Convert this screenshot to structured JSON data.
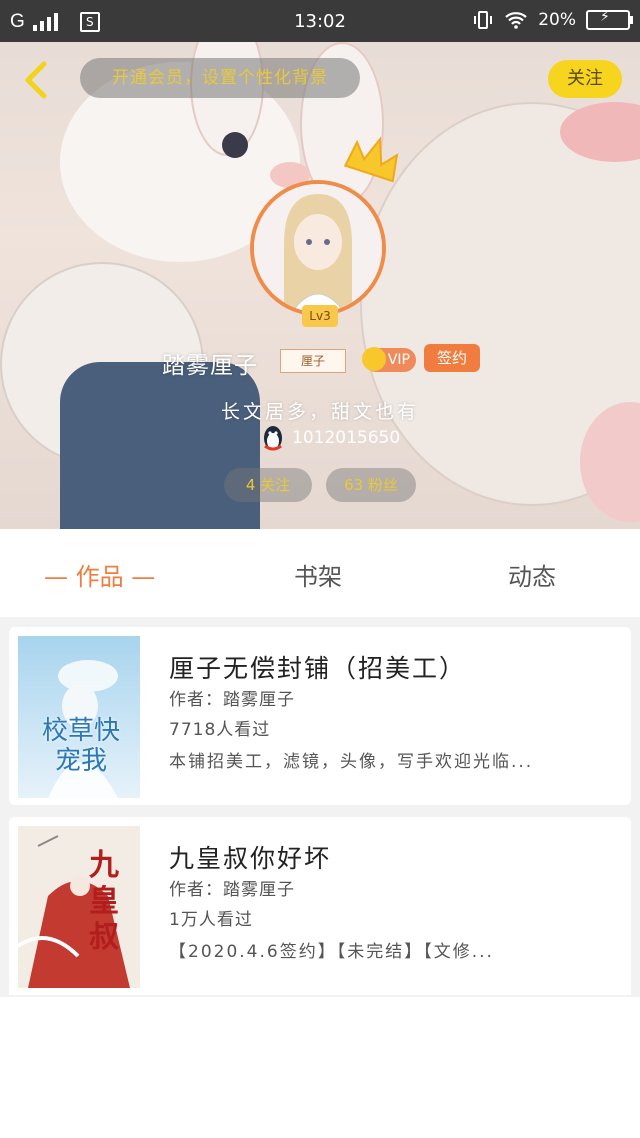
{
  "status_bar": {
    "carrier": "G",
    "sim_icon": "S",
    "time": "13:02",
    "battery": "20%"
  },
  "header": {
    "notice": "开通会员，设置个性化背景",
    "follow_button": "关注",
    "level_badge": "Lv3",
    "username": "踏雾厘子",
    "name_tag": "厘子",
    "vip_badge": "VIP",
    "signed_badge": "签约",
    "bio": "长文居多，甜文也有",
    "qq": "1012015650",
    "following": "4 关注",
    "fans": "63 粉丝"
  },
  "tabs": [
    {
      "label": "— 作品 —",
      "active": true
    },
    {
      "label": "书架",
      "active": false
    },
    {
      "label": "动态",
      "active": false
    }
  ],
  "books": [
    {
      "title": "厘子无偿封铺（招美工）",
      "author": "作者：踏雾厘子",
      "views": "7718人看过",
      "desc": "本铺招美工，滤镜，头像，写手欢迎光临...",
      "cover_text": "校草快宠我"
    },
    {
      "title": "九皇叔你好坏",
      "author": "作者：踏雾厘子",
      "views": "1万人看过",
      "desc": "【2020.4.6签约】【未完结】【文修...",
      "cover_text": "九皇叔"
    }
  ],
  "colors": {
    "accent": "#f07d3f",
    "follow_yellow": "#f7d51e",
    "status_bar": "#3a3a3a"
  }
}
